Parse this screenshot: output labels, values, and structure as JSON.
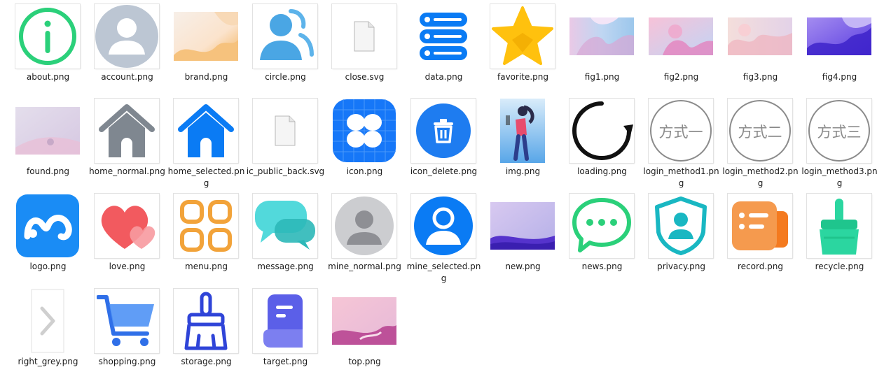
{
  "explorer": {
    "files": [
      {
        "name": "about.png",
        "icon": "info-circle-icon"
      },
      {
        "name": "account.png",
        "icon": "account-avatar-icon"
      },
      {
        "name": "brand.png",
        "icon": "brand-image"
      },
      {
        "name": "circle.png",
        "icon": "users-icon"
      },
      {
        "name": "close.svg",
        "icon": "generic-file-icon"
      },
      {
        "name": "data.png",
        "icon": "database-icon"
      },
      {
        "name": "favorite.png",
        "icon": "star-icon"
      },
      {
        "name": "fig1.png",
        "icon": "fig-image"
      },
      {
        "name": "fig2.png",
        "icon": "fig-image"
      },
      {
        "name": "fig3.png",
        "icon": "fig-image"
      },
      {
        "name": "fig4.png",
        "icon": "fig-image"
      },
      {
        "name": "found.png",
        "icon": "found-image"
      },
      {
        "name": "home_normal.png",
        "icon": "home-grey-icon"
      },
      {
        "name": "home_selected.png",
        "icon": "home-blue-icon"
      },
      {
        "name": "ic_public_back.svg",
        "icon": "generic-file-icon"
      },
      {
        "name": "icon.png",
        "icon": "app-grid-icon"
      },
      {
        "name": "icon_delete.png",
        "icon": "delete-icon"
      },
      {
        "name": "img.png",
        "icon": "woman-illustration-image"
      },
      {
        "name": "loading.png",
        "icon": "loading-icon"
      },
      {
        "name": "login_method1.png",
        "icon": "login-method-icon",
        "glyph": "方式一"
      },
      {
        "name": "login_method2.png",
        "icon": "login-method-icon",
        "glyph": "方式二"
      },
      {
        "name": "login_method3.png",
        "icon": "login-method-icon",
        "glyph": "方式三"
      },
      {
        "name": "logo.png",
        "icon": "logo-icon"
      },
      {
        "name": "love.png",
        "icon": "heart-icon"
      },
      {
        "name": "menu.png",
        "icon": "menu-grid-icon"
      },
      {
        "name": "message.png",
        "icon": "message-bubbles-icon"
      },
      {
        "name": "mine_normal.png",
        "icon": "user-grey-icon"
      },
      {
        "name": "mine_selected.png",
        "icon": "user-blue-icon"
      },
      {
        "name": "new.png",
        "icon": "new-image"
      },
      {
        "name": "news.png",
        "icon": "chat-bubble-icon"
      },
      {
        "name": "privacy.png",
        "icon": "shield-user-icon"
      },
      {
        "name": "record.png",
        "icon": "record-list-icon"
      },
      {
        "name": "recycle.png",
        "icon": "broom-icon"
      },
      {
        "name": "right_grey.png",
        "icon": "chevron-right-icon"
      },
      {
        "name": "shopping.png",
        "icon": "shopping-cart-icon"
      },
      {
        "name": "storage.png",
        "icon": "broom-outline-icon"
      },
      {
        "name": "target.png",
        "icon": "document-icon"
      },
      {
        "name": "top.png",
        "icon": "top-image"
      }
    ]
  },
  "colors": {
    "accent_blue": "#0A7BF4",
    "green": "#2BD07A",
    "grey": "#7F8790",
    "label_text": "#1B1B1B"
  }
}
